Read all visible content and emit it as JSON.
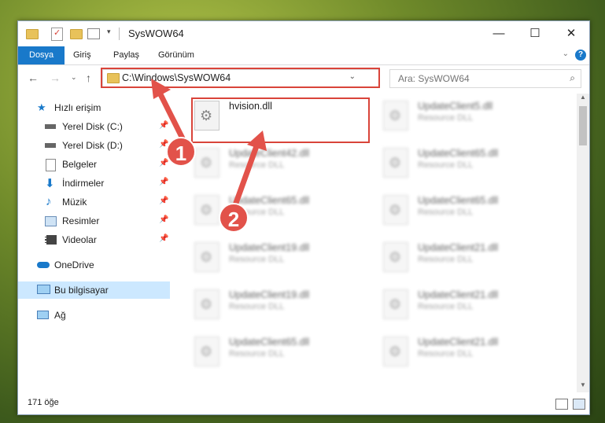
{
  "window": {
    "title": "SysWOW64",
    "controls": {
      "minimize": "—",
      "maximize": "☐",
      "close": "✕"
    }
  },
  "ribbon": {
    "tabs": [
      "Dosya",
      "Giriş",
      "Paylaş",
      "Görünüm"
    ],
    "help": "?"
  },
  "nav": {
    "address": "C:\\Windows\\SysWOW64",
    "search_placeholder": "Ara: SysWOW64"
  },
  "sidebar": {
    "items": [
      {
        "label": "Hızlı erişim",
        "icon": "star-icon",
        "pinned": false
      },
      {
        "label": "Yerel Disk (C:)",
        "icon": "drive-icon",
        "pinned": true
      },
      {
        "label": "Yerel Disk (D:)",
        "icon": "drive-icon",
        "pinned": true
      },
      {
        "label": "Belgeler",
        "icon": "documents-icon",
        "pinned": true
      },
      {
        "label": "İndirmeler",
        "icon": "download-icon",
        "pinned": true
      },
      {
        "label": "Müzik",
        "icon": "music-icon",
        "pinned": true
      },
      {
        "label": "Resimler",
        "icon": "pictures-icon",
        "pinned": true
      },
      {
        "label": "Videolar",
        "icon": "videos-icon",
        "pinned": true
      },
      {
        "label": "OneDrive",
        "icon": "cloud-icon",
        "pinned": false
      },
      {
        "label": "Bu bilgisayar",
        "icon": "computer-icon",
        "pinned": false
      },
      {
        "label": "Ağ",
        "icon": "network-icon",
        "pinned": false
      }
    ]
  },
  "files": [
    {
      "name": "hvision.dll",
      "desc": ""
    },
    {
      "name": "UpdateClient5.dll",
      "desc": "Resource DLL"
    },
    {
      "name": "UpdateClient42.dll",
      "desc": "Resource DLL"
    },
    {
      "name": "UpdateClient65.dll",
      "desc": "Resource DLL"
    },
    {
      "name": "UpdateClient65.dll",
      "desc": "Resource DLL"
    },
    {
      "name": "UpdateClient65.dll",
      "desc": "Resource DLL"
    },
    {
      "name": "UpdateClient19.dll",
      "desc": "Resource DLL"
    },
    {
      "name": "UpdateClient21.dll",
      "desc": "Resource DLL"
    },
    {
      "name": "UpdateClient19.dll",
      "desc": "Resource DLL"
    },
    {
      "name": "UpdateClient21.dll",
      "desc": "Resource DLL"
    },
    {
      "name": "UpdateClient65.dll",
      "desc": "Resource DLL"
    },
    {
      "name": "UpdateClient21.dll",
      "desc": "Resource DLL"
    }
  ],
  "status": {
    "count": "171 öğe"
  },
  "annotations": {
    "step1": "1",
    "step2": "2",
    "color": "#e2524a"
  }
}
